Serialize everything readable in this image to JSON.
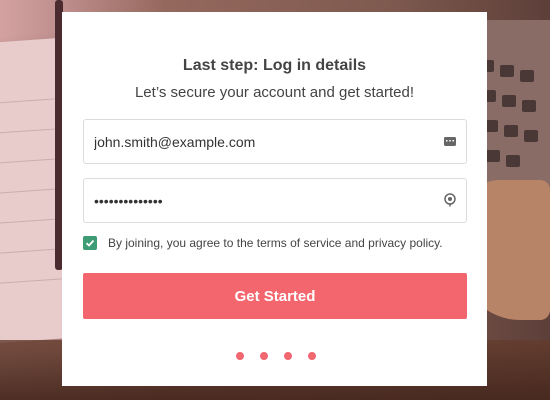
{
  "card": {
    "title": "Last step: Log in details",
    "subtitle": "Let’s secure your account and get started!"
  },
  "form": {
    "email_value": "john.smith@example.com",
    "email_icon": "keyboard-icon",
    "password_value": "••••••••••••••",
    "password_icon": "location-pin-icon",
    "agree_checked": true,
    "agree_prefix": "By joining, you agree to the ",
    "terms_link": "terms of service",
    "agree_and": " and ",
    "privacy_link": "privacy policy",
    "agree_suffix": ".",
    "submit_label": "Get Started"
  },
  "pagination": {
    "dot_count": 4
  },
  "colors": {
    "accent": "#f4666e",
    "checkbox": "#3d9c73",
    "text": "#444444"
  }
}
